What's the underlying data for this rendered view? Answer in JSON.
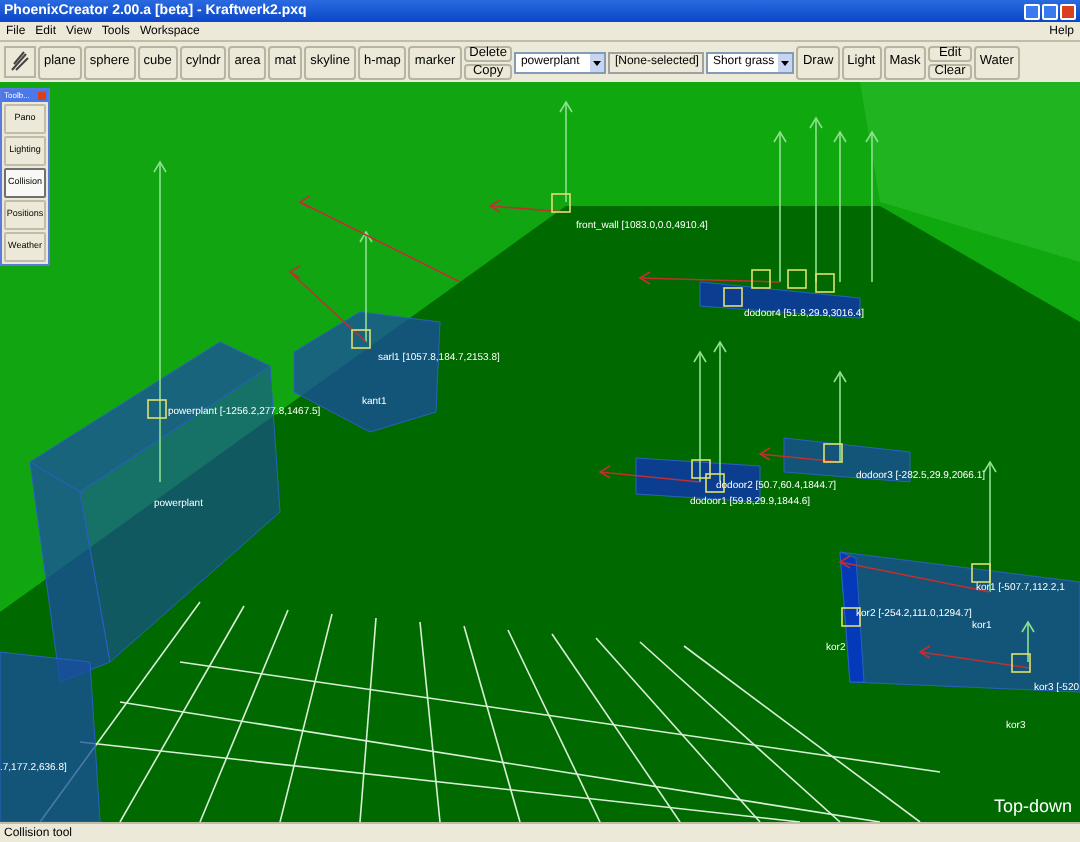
{
  "window": {
    "title": "PhoenixCreator 2.00.a [beta] - Kraftwerk2.pxq"
  },
  "menu": [
    "File",
    "Edit",
    "View",
    "Tools",
    "Workspace"
  ],
  "help_menu": "Help",
  "toolbar": {
    "buttons": [
      "plane",
      "sphere",
      "cube",
      "cylndr",
      "area",
      "mat",
      "skyline",
      "h-map",
      "marker"
    ],
    "stacked_1": [
      "Delete",
      "Copy"
    ],
    "object_select": "powerplant",
    "selection_field": "[None-selected]",
    "ground_select": "Short grass",
    "paint_buttons": [
      "Draw",
      "Light",
      "Mask"
    ],
    "stacked_2": [
      "Edit",
      "Clear"
    ],
    "water_button": "Water"
  },
  "tools_window": {
    "title": "Toolb...",
    "buttons": [
      {
        "label": "Pano",
        "selected": false
      },
      {
        "label": "Lighting",
        "selected": false
      },
      {
        "label": "Collision",
        "selected": true
      },
      {
        "label": "Positions",
        "selected": false
      },
      {
        "label": "Weather",
        "selected": false
      }
    ]
  },
  "viewport": {
    "labels": [
      "front_wall [1083.0,0.0,4910.4]",
      "dodoor4 [51.8,29.9,3016.4]",
      "sarl1 [1057.8,184.7,2153.8]",
      "powerplant [-1256.2,277.8,1467.5]",
      "kant1",
      "powerplant",
      "dodoor2 [50.7,60.4,1844.7]",
      "dodoor1 [59.8,29.9,1844.6]",
      "dodoor3 [-282.5,29.9,2066.1]",
      "kor1 [-507.7,112.2,1",
      "kor2 [-254.2,111.0,1294.7]",
      "kor1",
      "kor2",
      "kor3 [-520",
      "kor3",
      ".7,177.2,636.8]"
    ],
    "view_name": "Top-down"
  },
  "status_bar": "Collision tool"
}
